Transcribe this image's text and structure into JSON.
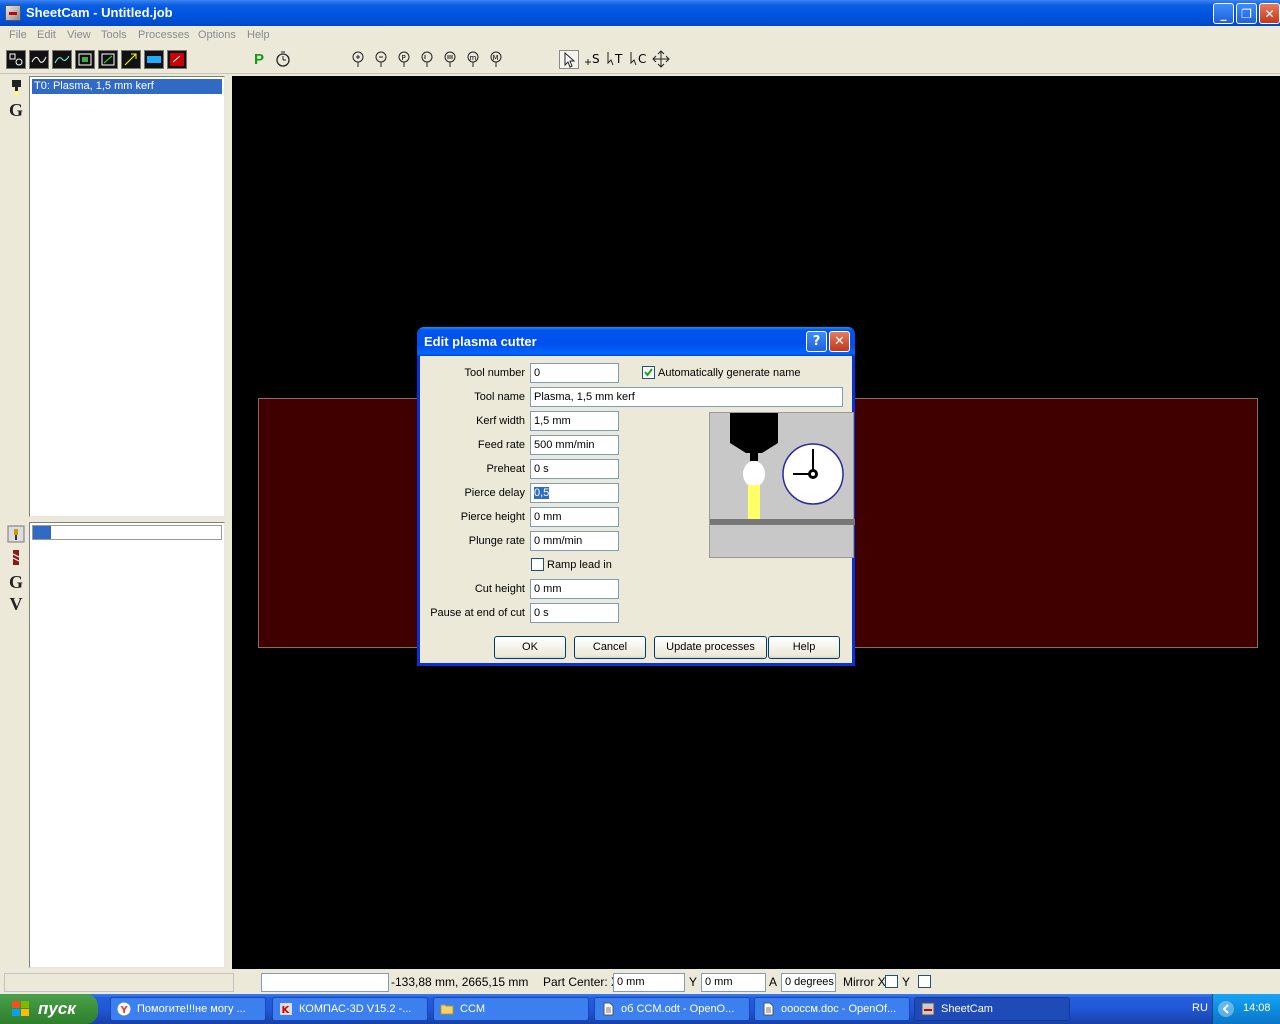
{
  "window": {
    "title": "SheetCam - Untitled.job",
    "minimize_glyph": "_",
    "restore_glyph": "❐",
    "close_glyph": "✕"
  },
  "menu": [
    "File",
    "Edit",
    "View",
    "Tools",
    "Processes",
    "Options",
    "Help"
  ],
  "toolbar": {
    "process_label": "P"
  },
  "tools_panel": {
    "items": [
      "T0: Plasma, 1,5 mm kerf"
    ],
    "icons": [
      "torch-icon",
      "gcode-icon"
    ],
    "gcode_letter": "G"
  },
  "operations_panel": {
    "icons": [
      "spindle-icon",
      "drill-icon",
      "gcode-icon",
      "vcode-icon"
    ],
    "letters": [
      "G",
      "V"
    ]
  },
  "dialog": {
    "title": "Edit plasma cutter",
    "help_glyph": "?",
    "close_glyph": "✕",
    "fields": {
      "tool_number": {
        "label": "Tool number",
        "value": "0"
      },
      "tool_name": {
        "label": "Tool name",
        "value": "Plasma, 1,5 mm kerf"
      },
      "kerf_width": {
        "label": "Kerf width",
        "value": "1,5 mm"
      },
      "feed_rate": {
        "label": "Feed rate",
        "value": "500 mm/min"
      },
      "preheat": {
        "label": "Preheat",
        "value": "0 s"
      },
      "pierce_delay": {
        "label": "Pierce delay",
        "value": "0,5"
      },
      "pierce_height": {
        "label": "Pierce height",
        "value": "0 mm"
      },
      "plunge_rate": {
        "label": "Plunge rate",
        "value": "0 mm/min"
      },
      "cut_height": {
        "label": "Cut height",
        "value": "0 mm"
      },
      "pause_end": {
        "label": "Pause at end of cut",
        "value": "0 s"
      }
    },
    "auto_name": {
      "label": "Automatically generate name",
      "checked": true
    },
    "ramp_lead_in": {
      "label": "Ramp lead in",
      "checked": false
    },
    "buttons": {
      "ok": "OK",
      "cancel": "Cancel",
      "update": "Update processes",
      "help": "Help"
    }
  },
  "statusbar": {
    "coords": "-133,88 mm, 2665,15 mm",
    "part_center_label": "Part Center: X",
    "x_value": "0 mm",
    "y_label": "Y",
    "y_value": "0 mm",
    "a_label": "A",
    "a_value": "0 degrees",
    "mirror_label": "Mirror X",
    "mirror_y_label": "Y",
    "mirror_x_checked": false,
    "mirror_y_checked": false
  },
  "taskbar": {
    "start_label": "пуск",
    "tasks": [
      {
        "label": "Помогите!!!не могу ...",
        "icon": "yandex-browser-icon"
      },
      {
        "label": "КОМПАС-3D V15.2  -...",
        "icon": "kompas-icon"
      },
      {
        "label": "CCM",
        "icon": "folder-icon"
      },
      {
        "label": "об CCM.odt - OpenO...",
        "icon": "document-icon"
      },
      {
        "label": "ооосcм.doc - OpenOf...",
        "icon": "document-icon"
      },
      {
        "label": "SheetCam",
        "icon": "sheetcam-icon"
      }
    ],
    "language": "RU",
    "clock": "14:08"
  },
  "colors": {
    "canvas": "#000000",
    "part_fill": "#400000",
    "selection": "#316ac5",
    "xp_blue": "#0054e3"
  }
}
